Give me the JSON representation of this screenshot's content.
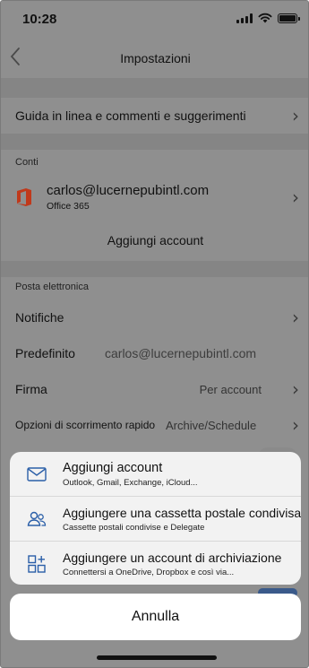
{
  "status_bar": {
    "time": "10:28"
  },
  "nav": {
    "title": "Impostazioni",
    "back_icon": "chevron-left-icon"
  },
  "help_row": {
    "label": "Guida in linea e commenti e suggerimenti"
  },
  "accounts_section": {
    "label": "Conti",
    "account": {
      "email": "carlos@lucernepubintl.com",
      "type": "Office 365"
    },
    "add_account_label": "Aggiungi account"
  },
  "mail_section": {
    "label": "Posta elettronica",
    "notifications": {
      "label": "Notifiche"
    },
    "default": {
      "label": "Predefinito",
      "value": "carlos@lucernepubintl.com"
    },
    "signature": {
      "label": "Firma",
      "value": "Per account"
    },
    "swipe": {
      "label": "Opzioni di scorrimento rapido",
      "value": "Archive/Schedule"
    }
  },
  "action_sheet": {
    "options": [
      {
        "icon": "envelope-icon",
        "title": "Aggiungi account",
        "subtitle": "Outlook, Gmail, Exchange, iCloud..."
      },
      {
        "icon": "shared-users-icon",
        "title": "Aggiungere una cassetta postale condivisa",
        "subtitle": "Cassette postali condivise e Delegate"
      },
      {
        "icon": "storage-grid-icon",
        "title": "Aggiungere un account di archiviazione",
        "subtitle": "Connettersi a OneDrive, Dropbox e così via..."
      }
    ],
    "cancel_label": "Annulla"
  },
  "colors": {
    "overlay": "#8f8f8f",
    "icon_blue": "#2b5fa8",
    "office_red": "#c0391b"
  }
}
